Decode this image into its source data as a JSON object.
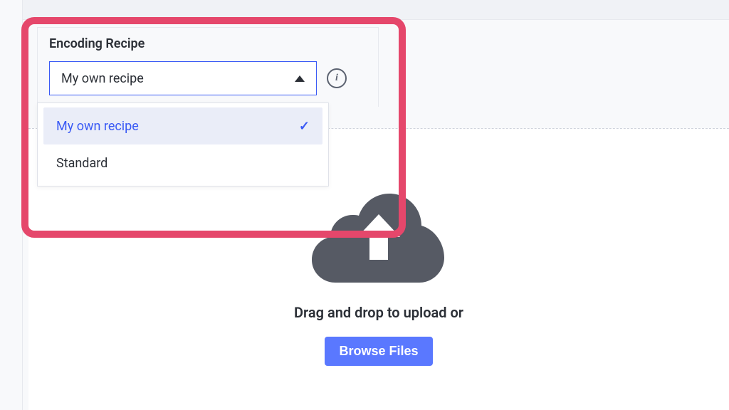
{
  "recipe": {
    "label": "Encoding Recipe",
    "selected": "My own recipe",
    "options": [
      {
        "label": "My own recipe",
        "selected": true
      },
      {
        "label": "Standard",
        "selected": false
      }
    ],
    "info_glyph": "i"
  },
  "upload": {
    "drop_text": "Drag and drop to upload or",
    "browse_label": "Browse Files"
  }
}
